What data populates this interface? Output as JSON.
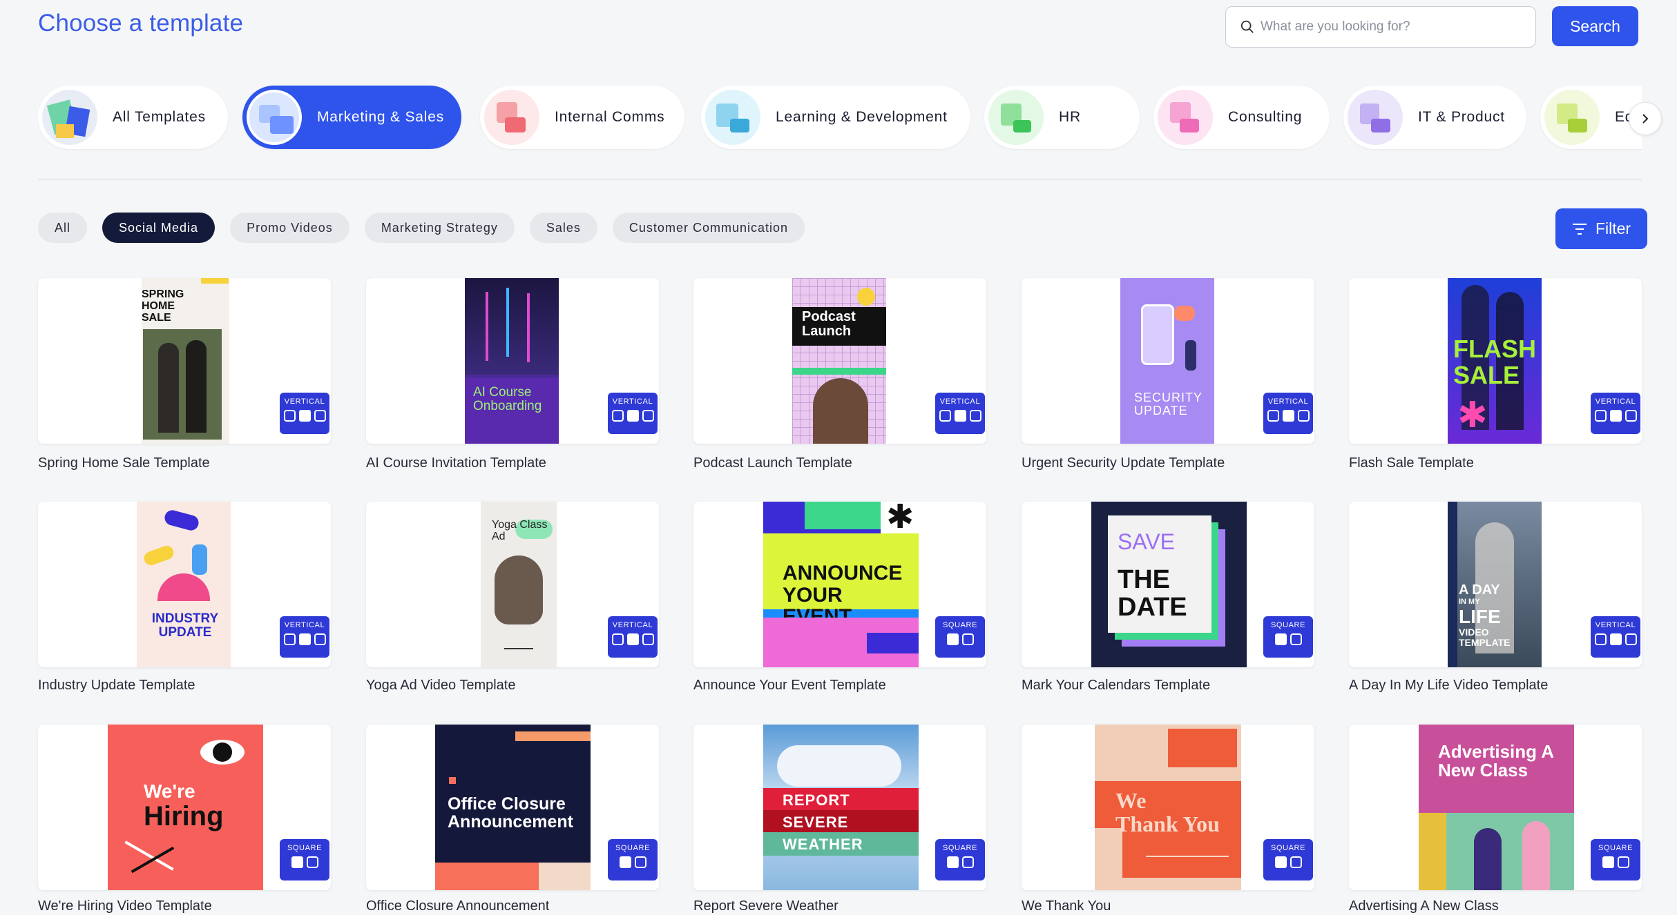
{
  "header": {
    "title": "Choose a template",
    "search_placeholder": "What are you looking for?",
    "search_label": "Search"
  },
  "categories": [
    {
      "label": "All Templates"
    },
    {
      "label": "Marketing & Sales"
    },
    {
      "label": "Internal Comms"
    },
    {
      "label": "Learning & Development"
    },
    {
      "label": "HR"
    },
    {
      "label": "Consulting"
    },
    {
      "label": "IT & Product"
    },
    {
      "label": "Educati"
    }
  ],
  "chips": [
    "All",
    "Social Media",
    "Promo Videos",
    "Marketing Strategy",
    "Sales",
    "Customer Communication"
  ],
  "filter_label": "Filter",
  "badges": {
    "vertical": "VERTICAL",
    "square": "SQUARE"
  },
  "cards": [
    {
      "caption": "Spring Home Sale Template",
      "art_text": "SPRING HOME SALE",
      "badge": "VERTICAL"
    },
    {
      "caption": "AI Course Invitation Template",
      "art_text": "AI Course Onboarding",
      "badge": "VERTICAL"
    },
    {
      "caption": "Podcast Launch Template",
      "art_text": "Podcast Launch",
      "badge": "VERTICAL"
    },
    {
      "caption": "Urgent Security Update Template",
      "art_text": "SECURITY UPDATE",
      "badge": "VERTICAL"
    },
    {
      "caption": "Flash Sale Template",
      "art_text": "FLASH SALE",
      "badge": "VERTICAL"
    },
    {
      "caption": "Industry Update Template",
      "art_text": "INDUSTRY UPDATE",
      "badge": "VERTICAL"
    },
    {
      "caption": "Yoga Ad Video Template",
      "art_text": "Yoga Class Ad",
      "badge": "VERTICAL"
    },
    {
      "caption": "Announce Your Event Template",
      "art_text": "ANNOUNCE YOUR EVENT",
      "badge": "SQUARE"
    },
    {
      "caption": "Mark Your Calendars Template",
      "art_text_1": "SAVE",
      "art_text_2": "THE DATE",
      "badge": "SQUARE"
    },
    {
      "caption": "A Day In My Life Video Template",
      "art_text_1": "A DAY",
      "art_text_2": "IN MY",
      "art_text_3": "LIFE",
      "art_text_4": "VIDEO TEMPLATE",
      "badge": "VERTICAL"
    },
    {
      "caption": "We're Hiring Video Template",
      "art_text_1": "We're",
      "art_text_2": "Hiring",
      "badge": "SQUARE"
    },
    {
      "caption": "Office Closure Announcement",
      "art_text": "Office Closure Announcement",
      "badge": "SQUARE"
    },
    {
      "caption": "Report Severe Weather",
      "art_text_1": "REPORT",
      "art_text_2": "SEVERE",
      "art_text_3": "WEATHER",
      "badge": "SQUARE"
    },
    {
      "caption": "We Thank You",
      "art_text_1": "We",
      "art_text_2": "Thank You",
      "badge": "SQUARE"
    },
    {
      "caption": "Advertising A New Class",
      "art_text": "Advertising A New Class",
      "badge": "SQUARE"
    }
  ],
  "colors": {
    "accent": "#2f54eb",
    "title": "#3b5ce6",
    "chip_active": "#141a3a",
    "badge": "#2f3ad6"
  }
}
